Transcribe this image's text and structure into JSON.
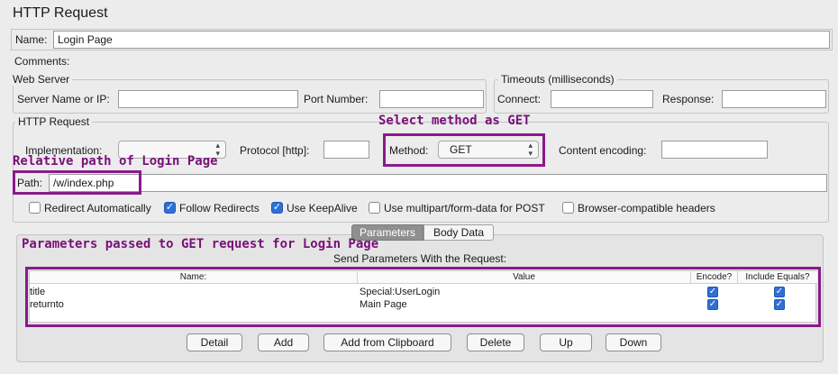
{
  "header": {
    "title": "HTTP Request"
  },
  "name_row": {
    "label": "Name:",
    "value": "Login Page"
  },
  "comments": {
    "label": "Comments:"
  },
  "web_server": {
    "legend": "Web Server",
    "server_label": "Server Name or IP:",
    "server_value": "",
    "port_label": "Port Number:",
    "port_value": ""
  },
  "timeouts": {
    "legend": "Timeouts (milliseconds)",
    "connect_label": "Connect:",
    "connect_value": "",
    "response_label": "Response:",
    "response_value": ""
  },
  "http_request": {
    "legend": "HTTP Request",
    "implementation_label": "Implementation:",
    "implementation_value": "",
    "protocol_label": "Protocol [http]:",
    "protocol_value": "",
    "method_label": "Method:",
    "method_value": "GET",
    "encoding_label": "Content encoding:",
    "encoding_value": "",
    "path_label": "Path:",
    "path_value": "/w/index.php"
  },
  "options": [
    {
      "label": "Redirect Automatically",
      "checked": false
    },
    {
      "label": "Follow Redirects",
      "checked": true
    },
    {
      "label": "Use KeepAlive",
      "checked": true
    },
    {
      "label": "Use multipart/form-data for POST",
      "checked": false
    },
    {
      "label": "Browser-compatible headers",
      "checked": false
    }
  ],
  "tabs": [
    {
      "label": "Parameters",
      "active": true
    },
    {
      "label": "Body Data",
      "active": false
    }
  ],
  "params": {
    "heading": "Send Parameters With the Request:",
    "columns": [
      "Name:",
      "Value",
      "Encode?",
      "Include Equals?"
    ],
    "rows": [
      {
        "name": "title",
        "value": "Special:UserLogin",
        "encode": true,
        "include_equals": true
      },
      {
        "name": "returnto",
        "value": "Main Page",
        "encode": true,
        "include_equals": true
      }
    ]
  },
  "buttons": [
    "Detail",
    "Add",
    "Add from Clipboard",
    "Delete",
    "Up",
    "Down"
  ],
  "annotations": {
    "method": "Select method as GET",
    "path": "Relative path of Login Page",
    "params": "Parameters passed to GET request for Login Page"
  },
  "colors": {
    "annotation": "#8a1a8a",
    "checkbox": "#2f6fd6",
    "background": "#ececec"
  }
}
